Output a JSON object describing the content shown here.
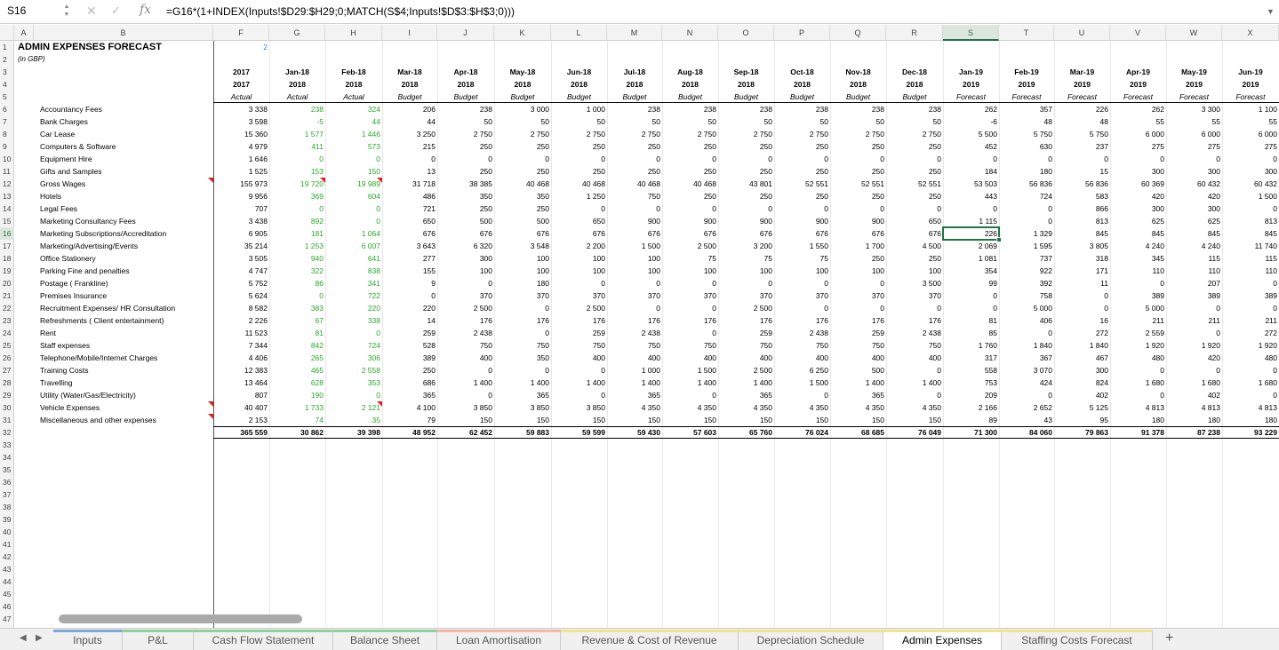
{
  "formula_bar": {
    "name_box": "S16",
    "formula": "=G16*(1+INDEX(Inputs!$D29:$H29;0;MATCH(S$4;Inputs!$D$3:$H$3;0)))"
  },
  "columns": [
    "A",
    "B",
    "F",
    "G",
    "H",
    "I",
    "J",
    "K",
    "L",
    "M",
    "N",
    "O",
    "P",
    "Q",
    "R",
    "S",
    "T",
    "U",
    "V",
    "W",
    "X"
  ],
  "selected_cell": {
    "column": "S",
    "row": 16
  },
  "sheet": {
    "title": "ADMIN EXPENSES FORECAST",
    "subtitle": "(in GBP)",
    "counter": "2",
    "periods": [
      "2017",
      "Jan-18",
      "Feb-18",
      "Mar-18",
      "Apr-18",
      "May-18",
      "Jun-18",
      "Jul-18",
      "Aug-18",
      "Sep-18",
      "Oct-18",
      "Nov-18",
      "Dec-18",
      "Jan-19",
      "Feb-19",
      "Mar-19",
      "Apr-19",
      "May-19",
      "Jun-19"
    ],
    "years": [
      "2017",
      "2018",
      "2018",
      "2018",
      "2018",
      "2018",
      "2018",
      "2018",
      "2018",
      "2018",
      "2018",
      "2018",
      "2018",
      "2019",
      "2019",
      "2019",
      "2019",
      "2019",
      "2019"
    ],
    "kinds": [
      "Actual",
      "Actual",
      "Actual",
      "Budget",
      "Budget",
      "Budget",
      "Budget",
      "Budget",
      "Budget",
      "Budget",
      "Budget",
      "Budget",
      "Budget",
      "Forecast",
      "Forecast",
      "Forecast",
      "Forecast",
      "Forecast",
      "Forecast"
    ],
    "rows": [
      {
        "label": "Accountancy Fees",
        "v": [
          "3 338",
          "238",
          "324",
          "206",
          "238",
          "3 000",
          "1 000",
          "238",
          "238",
          "238",
          "238",
          "238",
          "238",
          "262",
          "357",
          "226",
          "262",
          "3 300",
          "1 100"
        ]
      },
      {
        "label": "Bank Charges",
        "v": [
          "3 598",
          "-5",
          "44",
          "44",
          "50",
          "50",
          "50",
          "50",
          "50",
          "50",
          "50",
          "50",
          "50",
          "-6",
          "48",
          "48",
          "55",
          "55",
          "55"
        ]
      },
      {
        "label": "Car Lease",
        "v": [
          "15 360",
          "1 577",
          "1 446",
          "3 250",
          "2 750",
          "2 750",
          "2 750",
          "2 750",
          "2 750",
          "2 750",
          "2 750",
          "2 750",
          "2 750",
          "5 500",
          "5 750",
          "5 750",
          "6 000",
          "6 000",
          "6 000"
        ]
      },
      {
        "label": "Computers & Software",
        "v": [
          "4 979",
          "411",
          "573",
          "215",
          "250",
          "250",
          "250",
          "250",
          "250",
          "250",
          "250",
          "250",
          "250",
          "452",
          "630",
          "237",
          "275",
          "275",
          "275"
        ]
      },
      {
        "label": "Equipment Hire",
        "v": [
          "1 646",
          "0",
          "0",
          "0",
          "0",
          "0",
          "0",
          "0",
          "0",
          "0",
          "0",
          "0",
          "0",
          "0",
          "0",
          "0",
          "0",
          "0",
          "0"
        ]
      },
      {
        "label": "Gifts and Samples",
        "v": [
          "1 525",
          "153",
          "150",
          "13",
          "250",
          "250",
          "250",
          "250",
          "250",
          "250",
          "250",
          "250",
          "250",
          "184",
          "180",
          "15",
          "300",
          "300",
          "300"
        ]
      },
      {
        "label": "Gross Wages",
        "v": [
          "155 973",
          "19 720",
          "19 989",
          "31 718",
          "38 385",
          "40 468",
          "40 468",
          "40 468",
          "40 468",
          "43 801",
          "52 551",
          "52 551",
          "52 551",
          "53 503",
          "56 836",
          "56 836",
          "60 369",
          "60 432",
          "60 432"
        ]
      },
      {
        "label": "Hotels",
        "v": [
          "9 956",
          "369",
          "604",
          "486",
          "350",
          "350",
          "1 250",
          "750",
          "250",
          "250",
          "250",
          "250",
          "250",
          "443",
          "724",
          "583",
          "420",
          "420",
          "1 500"
        ]
      },
      {
        "label": "Legal Fees",
        "v": [
          "707",
          "0",
          "0",
          "721",
          "250",
          "250",
          "0",
          "0",
          "0",
          "0",
          "0",
          "0",
          "0",
          "0",
          "0",
          "866",
          "300",
          "300",
          "0"
        ]
      },
      {
        "label": "Marketing Consultancy Fees",
        "v": [
          "3 438",
          "892",
          "0",
          "650",
          "500",
          "500",
          "650",
          "900",
          "900",
          "900",
          "900",
          "900",
          "650",
          "1 115",
          "0",
          "813",
          "625",
          "625",
          "813"
        ]
      },
      {
        "label": "Marketing Subscriptions/Accreditation",
        "v": [
          "6 905",
          "181",
          "1 064",
          "676",
          "676",
          "676",
          "676",
          "676",
          "676",
          "676",
          "676",
          "676",
          "676",
          "226",
          "1 329",
          "845",
          "845",
          "845",
          "845"
        ]
      },
      {
        "label": "Marketing/Advertising/Events",
        "v": [
          "35 214",
          "1 253",
          "6 007",
          "3 643",
          "6 320",
          "3 548",
          "2 200",
          "1 500",
          "2 500",
          "3 200",
          "1 550",
          "1 700",
          "4 500",
          "2 069",
          "1 595",
          "3 805",
          "4 240",
          "4 240",
          "11 740"
        ]
      },
      {
        "label": "Office Stationery",
        "v": [
          "3 505",
          "940",
          "641",
          "277",
          "300",
          "100",
          "100",
          "100",
          "75",
          "75",
          "75",
          "250",
          "250",
          "1 081",
          "737",
          "318",
          "345",
          "115",
          "115"
        ]
      },
      {
        "label": "Parking Fine and penalties",
        "v": [
          "4 747",
          "322",
          "838",
          "155",
          "100",
          "100",
          "100",
          "100",
          "100",
          "100",
          "100",
          "100",
          "100",
          "354",
          "922",
          "171",
          "110",
          "110",
          "110"
        ]
      },
      {
        "label": "Postage ( Frankline)",
        "v": [
          "5 752",
          "86",
          "341",
          "9",
          "0",
          "180",
          "0",
          "0",
          "0",
          "0",
          "0",
          "0",
          "3 500",
          "99",
          "392",
          "11",
          "0",
          "207",
          "0"
        ]
      },
      {
        "label": "Premises Insurance",
        "v": [
          "5 624",
          "0",
          "722",
          "0",
          "370",
          "370",
          "370",
          "370",
          "370",
          "370",
          "370",
          "370",
          "370",
          "0",
          "758",
          "0",
          "389",
          "389",
          "389"
        ]
      },
      {
        "label": "Recruitment Expenses/ HR Consultation",
        "v": [
          "8 582",
          "383",
          "220",
          "220",
          "2 500",
          "0",
          "2 500",
          "0",
          "0",
          "2 500",
          "0",
          "0",
          "0",
          "0",
          "5 000",
          "0",
          "5 000",
          "0",
          "0"
        ]
      },
      {
        "label": "Refreshments ( Client entertainment)",
        "v": [
          "2 226",
          "67",
          "338",
          "14",
          "176",
          "176",
          "176",
          "176",
          "176",
          "176",
          "176",
          "176",
          "176",
          "81",
          "406",
          "16",
          "211",
          "211",
          "211"
        ]
      },
      {
        "label": "Rent",
        "v": [
          "11 523",
          "81",
          "0",
          "259",
          "2 438",
          "0",
          "259",
          "2 438",
          "0",
          "259",
          "2 438",
          "259",
          "2 438",
          "85",
          "0",
          "272",
          "2 559",
          "0",
          "272"
        ]
      },
      {
        "label": "Staff expenses",
        "v": [
          "7 344",
          "842",
          "724",
          "528",
          "750",
          "750",
          "750",
          "750",
          "750",
          "750",
          "750",
          "750",
          "750",
          "1 760",
          "1 840",
          "1 840",
          "1 920",
          "1 920",
          "1 920"
        ]
      },
      {
        "label": "Telephone/Mobile/Internet Charges",
        "v": [
          "4 406",
          "265",
          "306",
          "389",
          "400",
          "350",
          "400",
          "400",
          "400",
          "400",
          "400",
          "400",
          "400",
          "317",
          "367",
          "467",
          "480",
          "420",
          "480"
        ]
      },
      {
        "label": "Training Costs",
        "v": [
          "12 383",
          "465",
          "2 558",
          "250",
          "0",
          "0",
          "0",
          "1 000",
          "1 500",
          "2 500",
          "6 250",
          "500",
          "0",
          "558",
          "3 070",
          "300",
          "0",
          "0",
          "0"
        ]
      },
      {
        "label": "Travelling",
        "v": [
          "13 464",
          "628",
          "353",
          "686",
          "1 400",
          "1 400",
          "1 400",
          "1 400",
          "1 400",
          "1 400",
          "1 500",
          "1 400",
          "1 400",
          "753",
          "424",
          "824",
          "1 680",
          "1 680",
          "1 680"
        ]
      },
      {
        "label": "Utility (Water/Gas/Electricity)",
        "v": [
          "807",
          "190",
          "0",
          "365",
          "0",
          "365",
          "0",
          "365",
          "0",
          "365",
          "0",
          "365",
          "0",
          "209",
          "0",
          "402",
          "0",
          "402",
          "0"
        ]
      },
      {
        "label": "Vehicle Expenses",
        "v": [
          "40 407",
          "1 733",
          "2 121",
          "4 100",
          "3 850",
          "3 850",
          "3 850",
          "4 350",
          "4 350",
          "4 350",
          "4 350",
          "4 350",
          "4 350",
          "2 166",
          "2 652",
          "5 125",
          "4 813",
          "4 813",
          "4 813"
        ]
      },
      {
        "label": "Miscellaneous and other expenses",
        "v": [
          "2 153",
          "74",
          "35",
          "79",
          "150",
          "150",
          "150",
          "150",
          "150",
          "150",
          "150",
          "150",
          "150",
          "89",
          "43",
          "95",
          "180",
          "180",
          "180"
        ]
      }
    ],
    "totals": [
      "365 559",
      "30 862",
      "39 398",
      "48 952",
      "62 452",
      "59 883",
      "59 599",
      "59 430",
      "57 603",
      "65 760",
      "76 024",
      "68 685",
      "76 049",
      "71 300",
      "84 060",
      "79 863",
      "91 378",
      "87 238",
      "93 229"
    ]
  },
  "tabs": [
    {
      "label": "Inputs",
      "accent": "#7fa7d8"
    },
    {
      "label": "P&L",
      "accent": "#8fd19e"
    },
    {
      "label": "Cash Flow Statement",
      "accent": "#8fd19e"
    },
    {
      "label": "Balance Sheet",
      "accent": "#8fd19e"
    },
    {
      "label": "Loan Amortisation",
      "accent": "#f2b8a8"
    },
    {
      "label": "Revenue & Cost of Revenue",
      "accent": "#f0e68c"
    },
    {
      "label": "Depreciation Schedule",
      "accent": "#f0e68c"
    },
    {
      "label": "Admin Expenses",
      "accent": "#f0e68c",
      "active": true
    },
    {
      "label": "Staffing Costs Forecast",
      "accent": "#f0e68c"
    }
  ],
  "colors": {
    "accent_green": "#217346",
    "value_green": "#2aa82a",
    "note_red": "#e02020"
  }
}
